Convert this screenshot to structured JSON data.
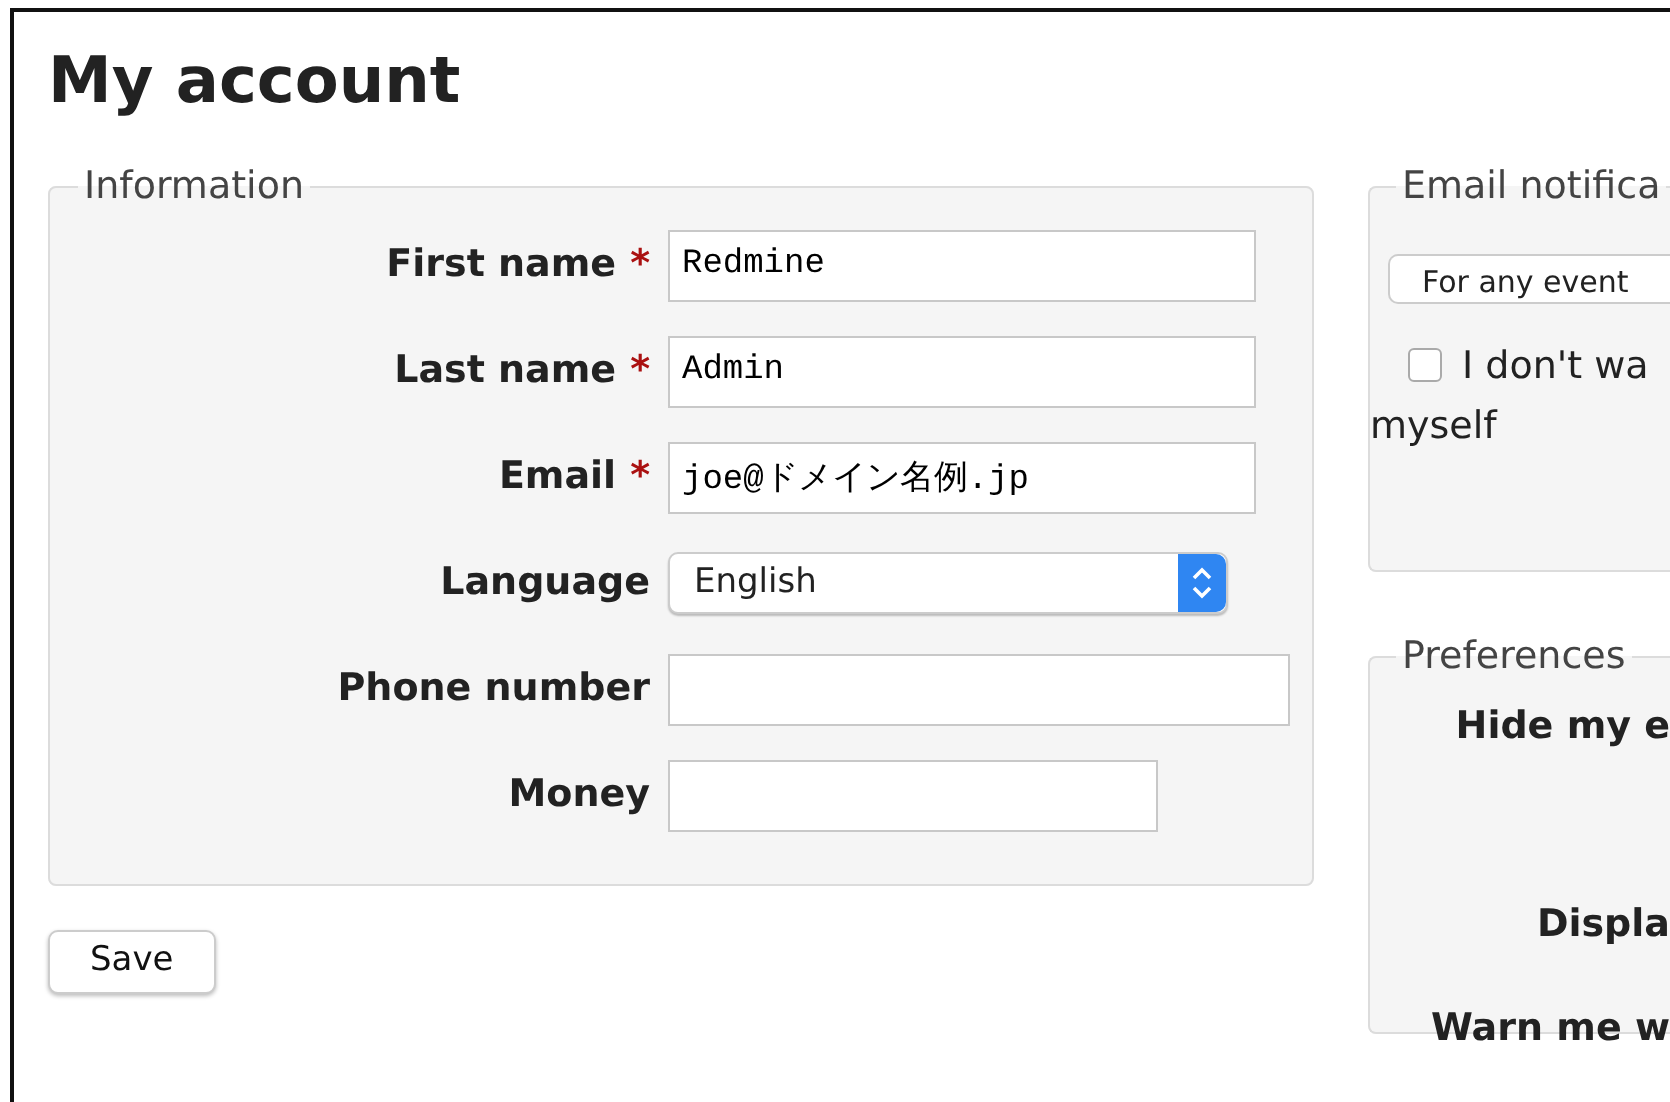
{
  "title": "My account",
  "information": {
    "legend": "Information",
    "fields": [
      {
        "label": "First name",
        "required_mark": "*",
        "kind": "text",
        "value": "Redmine"
      },
      {
        "label": "Last name",
        "required_mark": "*",
        "kind": "text",
        "value": "Admin"
      },
      {
        "label": "Email",
        "required_mark": "*",
        "kind": "text",
        "value": "joe@ドメイン名例.jp"
      },
      {
        "label": "Language",
        "kind": "select",
        "value": "English"
      },
      {
        "label": "Phone number",
        "kind": "text"
      },
      {
        "label": "Money",
        "kind": "text"
      }
    ]
  },
  "save_button": "Save",
  "email_notifications": {
    "legend": "Email notifica",
    "select_value": "For any event",
    "checkbox": {
      "checked": false,
      "label_lines": [
        "I don't wa",
        "myself"
      ]
    }
  },
  "preferences": {
    "legend": "Preferences",
    "labels": [
      "Hide my e",
      "Displa",
      "Warn me w"
    ]
  }
}
